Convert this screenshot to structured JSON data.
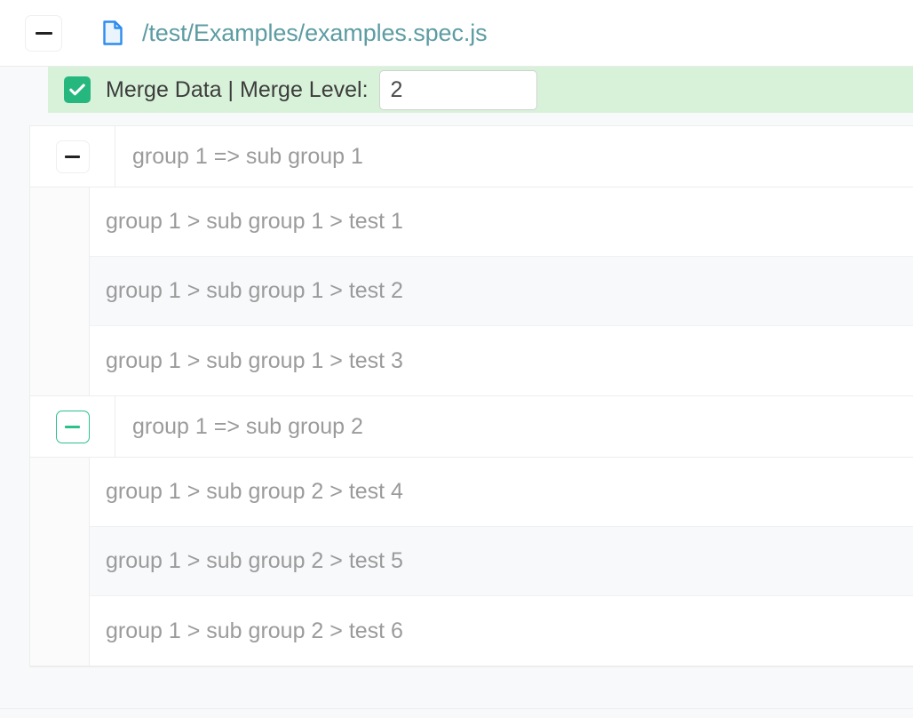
{
  "header": {
    "collapse_icon": "minus-icon",
    "file_icon": "file-document-icon",
    "file_path": "/test/Examples/examples.spec.js",
    "path_color": "#5d9ca3"
  },
  "merge_bar": {
    "checkbox_icon": "checkmark-icon",
    "checked": true,
    "label": "Merge Data  | Merge Level:",
    "level_value": "2",
    "level_placeholder": "",
    "background_color": "#d8f2da",
    "checkbox_color": "#25b77e"
  },
  "groups": [
    {
      "toggle_icon": "minus-icon",
      "toggle_accent": false,
      "title": "group 1 => sub group 1",
      "tests": [
        "group 1 > sub group 1 > test 1",
        "group 1 > sub group 1 > test 2",
        "group 1 > sub group 1 > test 3"
      ]
    },
    {
      "toggle_icon": "minus-icon",
      "toggle_accent": true,
      "title": "group 1 => sub group 2",
      "tests": [
        "group 1 > sub group 2 > test 4",
        "group 1 > sub group 2 > test 5",
        "group 1 > sub group 2 > test 6"
      ]
    }
  ],
  "colors": {
    "accent_green": "#2cc08a",
    "text_muted": "#9b9b9b",
    "panel_bg": "#f8f9fa"
  }
}
